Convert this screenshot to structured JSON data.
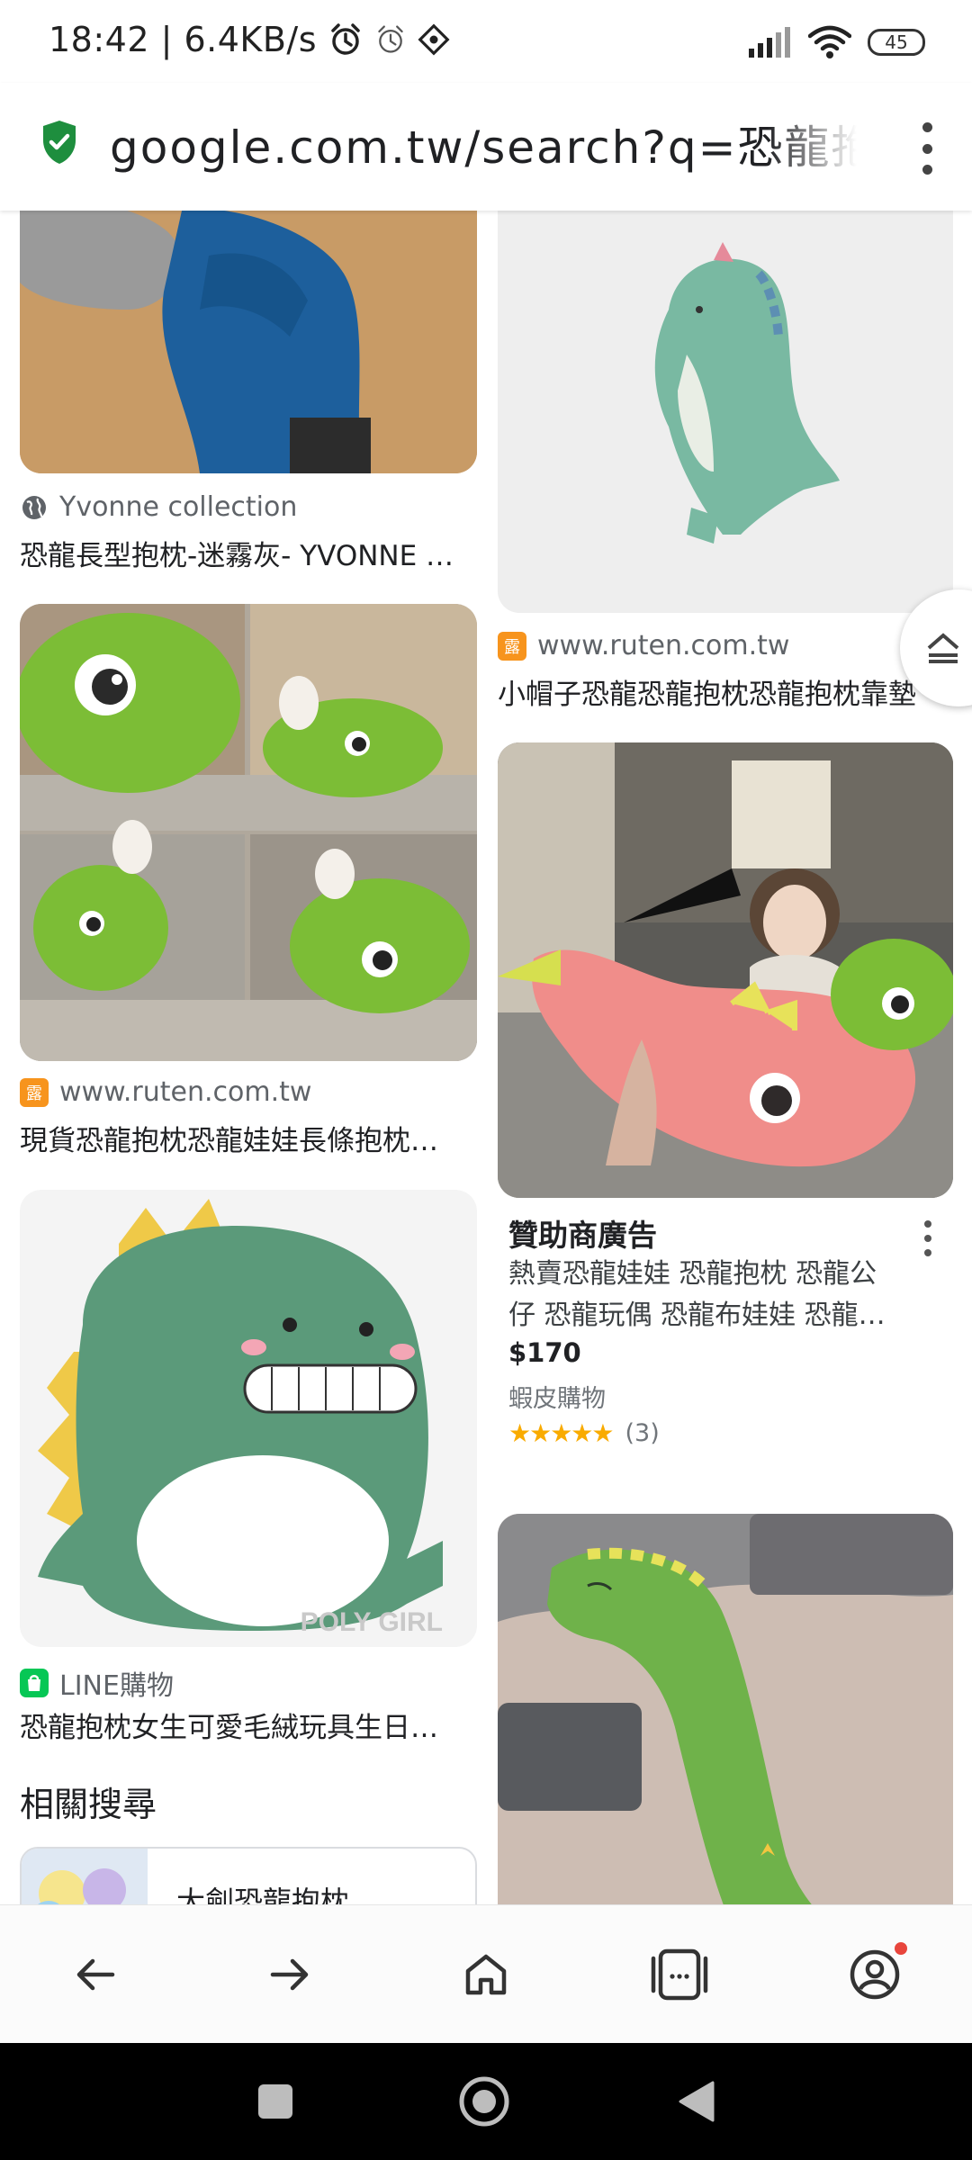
{
  "status_bar": {
    "time_speed": "18:42 | 6.4KB/s",
    "battery": "45"
  },
  "url_bar": {
    "url": "google.com.tw/search?q=恐龍抱枕"
  },
  "results": [
    {
      "source": "Yvonne collection",
      "title": "恐龍長型抱枕-迷霧灰- YVONNE COLLECTION",
      "favicon": "globe-icon"
    },
    {
      "source": "www.ruten.com.tw",
      "title": "小帽子恐龍恐龍抱枕恐龍抱枕靠墊",
      "favicon": "ruten-icon"
    },
    {
      "source": "www.ruten.com.tw",
      "title": "現貨恐龍抱枕恐龍娃娃長條抱枕抱枕",
      "favicon": "ruten-icon"
    },
    {
      "source": "LINE購物",
      "title": "恐龍抱枕女生可愛毛絨玩具生日禮物",
      "favicon": "line-shopping-icon"
    }
  ],
  "ad": {
    "label": "贊助商廣告",
    "desc_line1": "熱賣恐龍娃娃 恐龍抱枕 恐龍公",
    "desc_line2": "仔 恐龍玩偶 恐龍布娃娃 恐龍抱枕",
    "price": "$170",
    "store": "蝦皮購物",
    "stars": "★★★★★",
    "rating_count": "(3)"
  },
  "related": {
    "title": "相關搜尋",
    "first_item": "大劍恐龍抱枕"
  },
  "image_watermark": "POLY GIRL",
  "colors": {
    "shield_green": "#1e8e3e",
    "ruten_orange": "#f7941d",
    "line_green": "#06c755",
    "star_yellow": "#f9ab00",
    "notification_red": "#e8453c"
  }
}
